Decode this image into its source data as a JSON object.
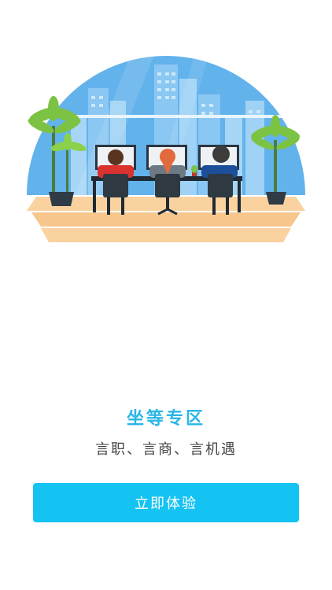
{
  "onboarding": {
    "title": "坐等专区",
    "subtitle": "言职、言商、言机遇",
    "cta_label": "立即体验"
  },
  "illustration": {
    "subject": "office workers at desks",
    "sky_color": "#62b2ec",
    "floor_color": "#f7c68c"
  },
  "colors": {
    "accent": "#29b6e8",
    "button": "#15c3f3",
    "subtitle": "#444444"
  }
}
